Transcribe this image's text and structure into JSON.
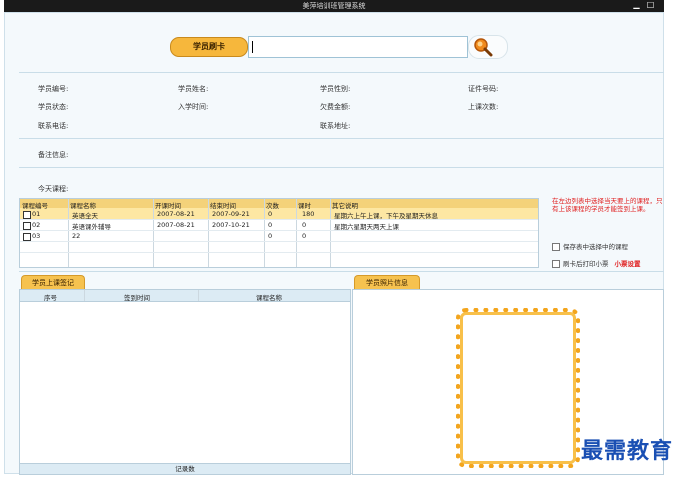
{
  "window": {
    "title": "美萍培训班管理系统",
    "minimize_glyph": "▁",
    "maximize_glyph": "□"
  },
  "card": {
    "button_label": "学员刷卡",
    "input_value": "",
    "search_icon": "magnifier-icon"
  },
  "student_fields": [
    {
      "label": "学员编号:"
    },
    {
      "label": "学员姓名:"
    },
    {
      "label": "学员性别:"
    },
    {
      "label": "证件号码:"
    },
    {
      "label": "学员状态:"
    },
    {
      "label": "入学时间:"
    },
    {
      "label": "欠费金额:"
    },
    {
      "label": "上课次数:"
    },
    {
      "label": "联系电话:"
    },
    {
      "label": "联系地址:"
    }
  ],
  "remark_label": "备注信息:",
  "today_label": "今天课程:",
  "courses": {
    "columns": [
      "课程编号",
      "课程名称",
      "开课时间",
      "结束时间",
      "次数",
      "课时",
      "其它说明"
    ],
    "rows": [
      [
        "01",
        "英语全天",
        "2007-08-21",
        "2007-09-21",
        "0",
        "180",
        "星期六上午上课，下午及星期天休息"
      ],
      [
        "02",
        "英语课外辅导",
        "2007-08-21",
        "2007-10-21",
        "0",
        "0",
        "星期六星期天两天上课"
      ],
      [
        "03",
        "22",
        "",
        "",
        "0",
        "0",
        ""
      ]
    ]
  },
  "hint_text": "在左边列表中选择当天要上的课程，只有上该课程的学员才能签到上课。",
  "options": {
    "save_selected": "保存表中选择中的课程",
    "print_ticket": "刷卡后打印小票",
    "ticket_settings": "小票设置"
  },
  "attendance": {
    "tab_label": "学员上课签记",
    "columns": [
      "序号",
      "签到时间",
      "课程名称"
    ],
    "footer": "记录数"
  },
  "photo": {
    "tab_label": "学员照片信息"
  },
  "watermark": "最需教育"
}
